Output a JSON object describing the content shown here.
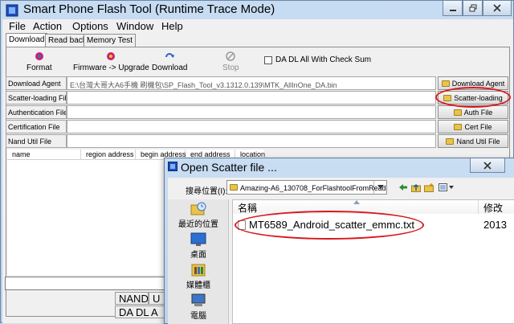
{
  "window": {
    "title": "Smart Phone Flash Tool (Runtime Trace Mode)"
  },
  "menu": {
    "items": [
      "File",
      "Action",
      "Options",
      "Window",
      "Help"
    ]
  },
  "tabs": [
    "Download",
    "Read back",
    "Memory Test"
  ],
  "toolbar": {
    "format": "Format",
    "firmware_upgrade": "Firmware -> Upgrade",
    "download": "Download",
    "stop": "Stop",
    "da_dl_checkbox": "DA DL All With Check Sum"
  },
  "rows": [
    {
      "label": "Download Agent",
      "value": "E:\\台灣大哥大A6手機 刷機包\\SP_Flash_Tool_v3.1312.0.139\\MTK_AllInOne_DA.bin",
      "button": "Download Agent"
    },
    {
      "label": "Scatter-loading File",
      "value": "",
      "button": "Scatter-loading"
    },
    {
      "label": "Authentication File",
      "value": "",
      "button": "Auth File"
    },
    {
      "label": "Certification File",
      "value": "",
      "button": "Cert File"
    },
    {
      "label": "Nand Util File",
      "value": "",
      "button": "Nand Util File"
    }
  ],
  "table": {
    "headers": [
      "name",
      "region address",
      "begin address",
      "end address",
      "location"
    ]
  },
  "status": {
    "nand": "NAND",
    "u": "U",
    "da_dl": "DA DL A"
  },
  "dialog": {
    "title": "Open Scatter file ...",
    "look_in_label": "搜尋位置(I):",
    "look_in_value": "Amazing-A6_130708_ForFlashtoolFromRead",
    "places": [
      "最近的位置",
      "桌面",
      "媒體櫃",
      "電腦"
    ],
    "columns": {
      "name": "名稱",
      "modified": "修改"
    },
    "files": [
      {
        "name": "MT6589_Android_scatter_emmc.txt",
        "date": "2013"
      }
    ]
  },
  "colors": {
    "highlight_ellipse": "#d9191f",
    "title_bar": "#c7dcf2"
  }
}
